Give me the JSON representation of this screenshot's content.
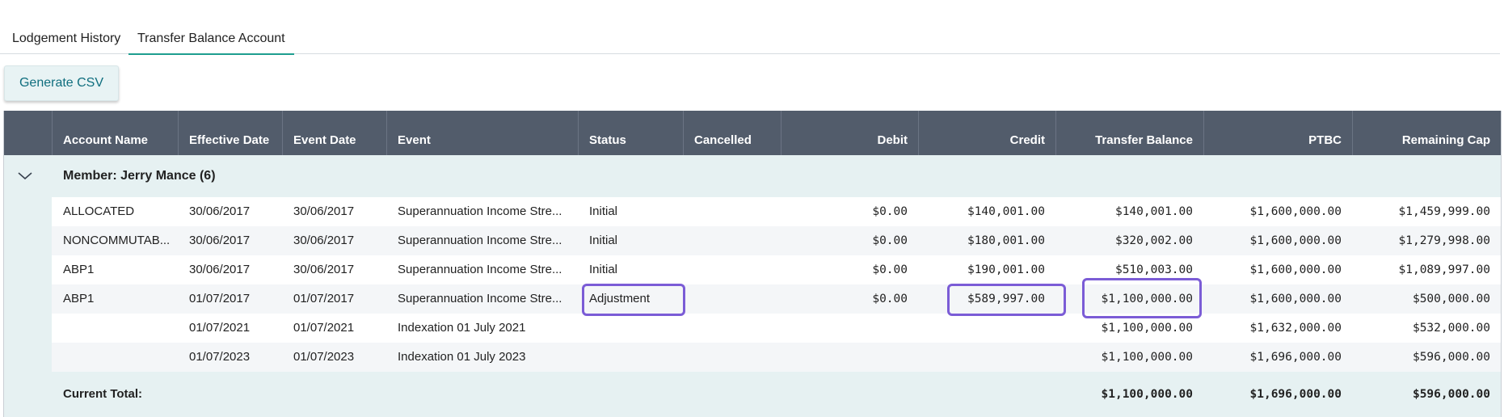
{
  "tabs": [
    {
      "label": "Lodgement History"
    },
    {
      "label": "Transfer Balance Account"
    }
  ],
  "toolbar": {
    "generate_csv_label": "Generate CSV"
  },
  "table": {
    "headers": [
      "Account Name",
      "Effective Date",
      "Event Date",
      "Event",
      "Status",
      "Cancelled",
      "Debit",
      "Credit",
      "Transfer Balance",
      "PTBC",
      "Remaining Cap"
    ],
    "group": {
      "label": "Member: Jerry Mance (6)",
      "expanded": true
    },
    "rows": [
      {
        "account_name": "ALLOCATED",
        "effective_date": "30/06/2017",
        "event_date": "30/06/2017",
        "event": "Superannuation Income Stre...",
        "status": "Initial",
        "cancelled": "",
        "debit": "$0.00",
        "credit": "$140,001.00",
        "transfer_balance": "$140,001.00",
        "ptbc": "$1,600,000.00",
        "remaining_cap": "$1,459,999.00"
      },
      {
        "account_name": "NONCOMMUTAB...",
        "effective_date": "30/06/2017",
        "event_date": "30/06/2017",
        "event": "Superannuation Income Stre...",
        "status": "Initial",
        "cancelled": "",
        "debit": "$0.00",
        "credit": "$180,001.00",
        "transfer_balance": "$320,002.00",
        "ptbc": "$1,600,000.00",
        "remaining_cap": "$1,279,998.00"
      },
      {
        "account_name": "ABP1",
        "effective_date": "30/06/2017",
        "event_date": "30/06/2017",
        "event": "Superannuation Income Stre...",
        "status": "Initial",
        "cancelled": "",
        "debit": "$0.00",
        "credit": "$190,001.00",
        "transfer_balance": "$510,003.00",
        "ptbc": "$1,600,000.00",
        "remaining_cap": "$1,089,997.00"
      },
      {
        "account_name": "ABP1",
        "effective_date": "01/07/2017",
        "event_date": "01/07/2017",
        "event": "Superannuation Income Stre...",
        "status": "Adjustment",
        "cancelled": "",
        "debit": "$0.00",
        "credit": "$589,997.00",
        "transfer_balance": "$1,100,000.00",
        "ptbc": "$1,600,000.00",
        "remaining_cap": "$500,000.00"
      },
      {
        "account_name": "",
        "effective_date": "01/07/2021",
        "event_date": "01/07/2021",
        "event": "Indexation 01 July 2021",
        "status": "",
        "cancelled": "",
        "debit": "",
        "credit": "",
        "transfer_balance": "$1,100,000.00",
        "ptbc": "$1,632,000.00",
        "remaining_cap": "$532,000.00"
      },
      {
        "account_name": "",
        "effective_date": "01/07/2023",
        "event_date": "01/07/2023",
        "event": "Indexation 01 July 2023",
        "status": "",
        "cancelled": "",
        "debit": "",
        "credit": "",
        "transfer_balance": "$1,100,000.00",
        "ptbc": "$1,696,000.00",
        "remaining_cap": "$596,000.00"
      }
    ],
    "total": {
      "label": "Current Total:",
      "transfer_balance": "$1,100,000.00",
      "ptbc": "$1,696,000.00",
      "remaining_cap": "$596,000.00"
    }
  },
  "highlight_color": "#7b5cd6",
  "accent_color": "#1e9e8f",
  "header_bg": "#525c6b"
}
